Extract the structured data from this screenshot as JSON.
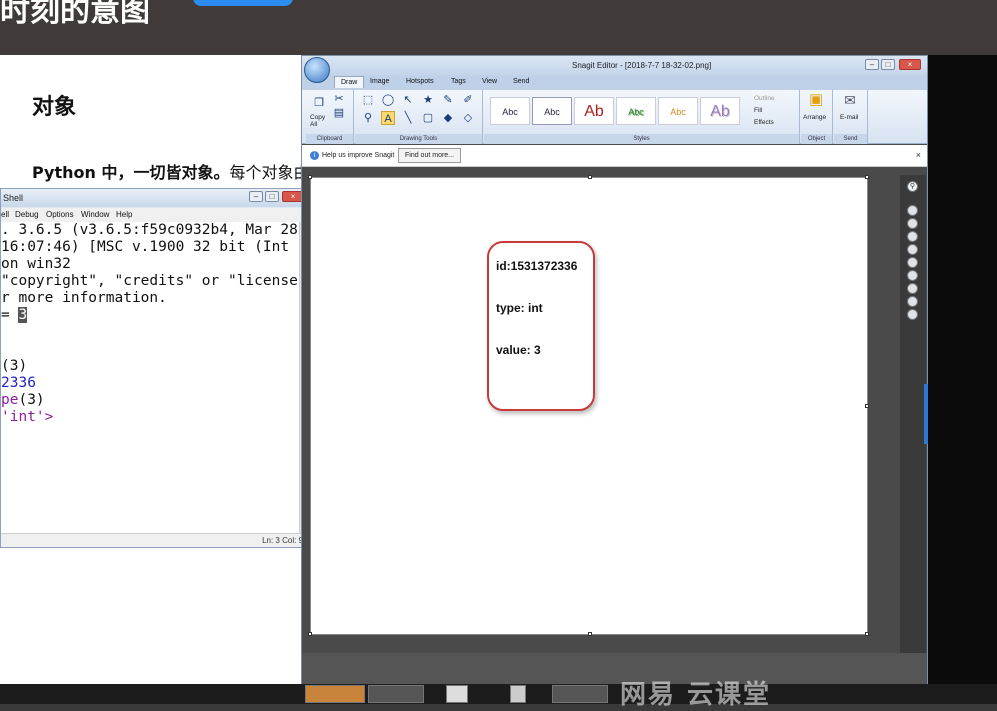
{
  "topbar": {
    "title": "时刻的意图"
  },
  "doc": {
    "heading": "对象",
    "para_bold": "Python 中，一切皆对象。",
    "para_rest": "每个对象由"
  },
  "shell": {
    "title": "Shell",
    "menu": [
      "ell",
      "Debug",
      "Options",
      "Window",
      "Help"
    ],
    "lines": [
      ". 3.6.5 (v3.6.5:f59c0932b4, Mar 28",
      "16:07:46) [MSC v.1900 32 bit (Int",
      "on win32",
      "\"copyright\", \"credits\" or \"license",
      "r more information."
    ],
    "prompt_prefix": "= ",
    "prompt_value": "3",
    "out1": "(3)",
    "out2": "2336",
    "out3_a": "pe",
    "out3_b": "(3)",
    "out4": "'int'>",
    "status": "Ln: 3   Col: 9"
  },
  "snagit": {
    "title": "Snagit Editor - [2018-7-7 18-32-02.png]",
    "tabs": [
      "Draw",
      "Image",
      "Hotspots",
      "Tags",
      "View",
      "Send"
    ],
    "clipboard": {
      "copy_all": "Copy All",
      "label": "Clipboard"
    },
    "drawing_tools_label": "Drawing Tools",
    "styles": [
      "Abc",
      "Abc",
      "Ab",
      "Abc",
      "Abc",
      "Ab"
    ],
    "styles_label": "Styles",
    "style_opts": [
      "Outline",
      "Fill",
      "Effects"
    ],
    "object": {
      "arrange": "Arrange",
      "label": "Object"
    },
    "send": {
      "email": "E-mail",
      "label": "Send"
    },
    "notice": {
      "message": "Help us improve Snagit",
      "button": "Find out more..."
    },
    "card": {
      "id": "id:1531372336",
      "type": "type: int",
      "value": "value:  3"
    }
  },
  "watermark": "网易 云课堂",
  "colors": {
    "accent": "#2d8cf0",
    "card_border": "#c83a3a",
    "shell_blue": "#2323c4",
    "shell_purple": "#8a1f9e"
  }
}
